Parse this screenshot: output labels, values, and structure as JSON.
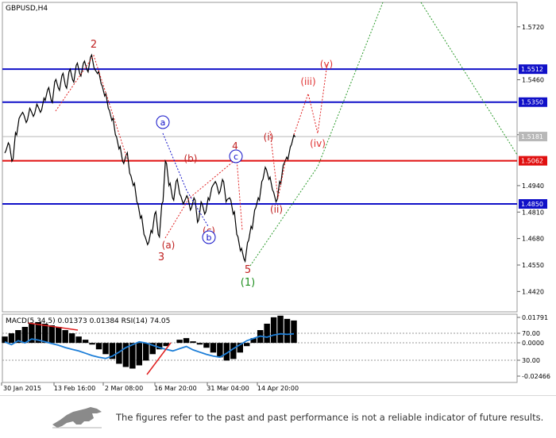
{
  "chart_data": [
    {
      "type": "line",
      "subtype": "candlestick-like price line with Elliott wave annotations",
      "title": "GBPUSD,H4",
      "ylim": [
        1.432,
        1.584
      ],
      "y_ticks": [
        "1.5720",
        "1.5460",
        "1.5190",
        "1.4940",
        "1.4810",
        "1.4680",
        "1.4550",
        "1.4420"
      ],
      "y_tick_values": [
        1.572,
        1.546,
        1.519,
        1.494,
        1.481,
        1.468,
        1.455,
        1.442
      ],
      "x_ticks": [
        "30 Jan 2015",
        "13 Feb 16:00",
        "2 Mar 08:00",
        "16 Mar 20:00",
        "31 Mar 04:00",
        "14 Apr 20:00"
      ],
      "levels": [
        {
          "label": "1.5512",
          "value": 1.5512,
          "color": "#1010c8"
        },
        {
          "label": "1.5350",
          "value": 1.535,
          "color": "#1010c8"
        },
        {
          "label": "1.5181",
          "value": 1.5181,
          "color": "#b8b8b8"
        },
        {
          "label": "1.5062",
          "value": 1.5062,
          "color": "#e01010"
        },
        {
          "label": "1.4850",
          "value": 1.485,
          "color": "#1010c8"
        }
      ],
      "price_series": [
        1.51,
        1.515,
        1.506,
        1.52,
        1.527,
        1.53,
        1.525,
        1.532,
        1.528,
        1.534,
        1.53,
        1.537,
        1.541,
        1.536,
        1.545,
        1.542,
        1.548,
        1.543,
        1.55,
        1.546,
        1.553,
        1.549,
        1.554,
        1.551,
        1.557,
        1.552,
        1.549,
        1.544,
        1.538,
        1.532,
        1.526,
        1.519,
        1.512,
        1.506,
        1.509,
        1.5,
        1.494,
        1.486,
        1.478,
        1.47,
        1.465,
        1.472,
        1.48,
        1.47,
        1.485,
        1.506,
        1.494,
        1.488,
        1.496,
        1.49,
        1.485,
        1.489,
        1.482,
        1.488,
        1.476,
        1.486,
        1.48,
        1.488,
        1.493,
        1.496,
        1.49,
        1.497,
        1.486,
        1.488,
        1.48,
        1.47,
        1.462,
        1.458,
        1.466,
        1.474,
        1.482,
        1.488,
        1.496,
        1.503,
        1.497,
        1.492,
        1.486,
        1.496,
        1.504,
        1.508,
        1.513,
        1.519
      ],
      "wave_labels": [
        {
          "text": "2",
          "color": "#c02020"
        },
        {
          "text": "a",
          "color": "#1010c8"
        },
        {
          "text": "(b)",
          "color": "#c02020"
        },
        {
          "text": "4",
          "color": "#c02020"
        },
        {
          "text": "c",
          "color": "#1010c8"
        },
        {
          "text": "(a)",
          "color": "#c02020"
        },
        {
          "text": "3",
          "color": "#c02020"
        },
        {
          "text": "(c)",
          "color": "#c02020"
        },
        {
          "text": "b",
          "color": "#1010c8"
        },
        {
          "text": "5",
          "color": "#c02020"
        },
        {
          "text": "(1)",
          "color": "#1f8f1f"
        },
        {
          "text": "(i)",
          "color": "#c02020"
        },
        {
          "text": "(ii)",
          "color": "#c02020"
        },
        {
          "text": "(iii)",
          "color": "#e03030"
        },
        {
          "text": "(iv)",
          "color": "#e03030"
        },
        {
          "text": "(v)",
          "color": "#e03030"
        }
      ]
    },
    {
      "type": "area",
      "title": "MACD(5,34,5) 0.01373 0.01384 RSI(14) 74.05",
      "y_ticks": [
        "0.01791",
        "70.00",
        "0.0000",
        "30.00",
        "-0.02466"
      ],
      "ylim": [
        -0.02466,
        0.01791
      ],
      "macd_histogram": [
        0.004,
        0.006,
        0.008,
        0.01,
        0.012,
        0.013,
        0.012,
        0.011,
        0.01,
        0.008,
        0.006,
        0.004,
        0.002,
        -0.001,
        -0.004,
        -0.007,
        -0.01,
        -0.013,
        -0.015,
        -0.016,
        -0.014,
        -0.011,
        -0.007,
        -0.004,
        -0.002,
        0.0,
        0.002,
        0.003,
        0.001,
        -0.001,
        -0.003,
        -0.006,
        -0.009,
        -0.011,
        -0.01,
        -0.006,
        -0.002,
        0.003,
        0.008,
        0.012,
        0.016,
        0.017,
        0.015,
        0.014
      ],
      "rsi": [
        60,
        55,
        62,
        58,
        65,
        63,
        60,
        57,
        54,
        50,
        47,
        44,
        40,
        36,
        33,
        31,
        35,
        42,
        50,
        55,
        60,
        58,
        54,
        50,
        47,
        44,
        48,
        52,
        46,
        42,
        38,
        35,
        33,
        40,
        48,
        55,
        62,
        66,
        70,
        68,
        72,
        74,
        73,
        74
      ]
    }
  ],
  "footer": {
    "disclaimer": "The figures refer to the past and past performance is not a reliable indicator of future results."
  }
}
